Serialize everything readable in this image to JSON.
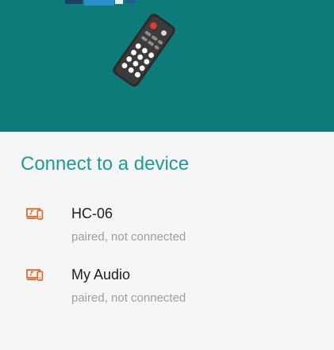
{
  "colors": {
    "header_background": "#0e7b7b",
    "title": "#1d9a9a",
    "device_icon": "#e06a2e",
    "content_background": "#f6f6f6"
  },
  "header": {
    "illustration": "remote-control-icon"
  },
  "dialog": {
    "title": "Connect to a device",
    "devices": [
      {
        "icon": "devices-icon",
        "name": "HC-06",
        "status": "paired, not connected"
      },
      {
        "icon": "devices-icon",
        "name": "My Audio",
        "status": "paired, not connected"
      }
    ]
  }
}
